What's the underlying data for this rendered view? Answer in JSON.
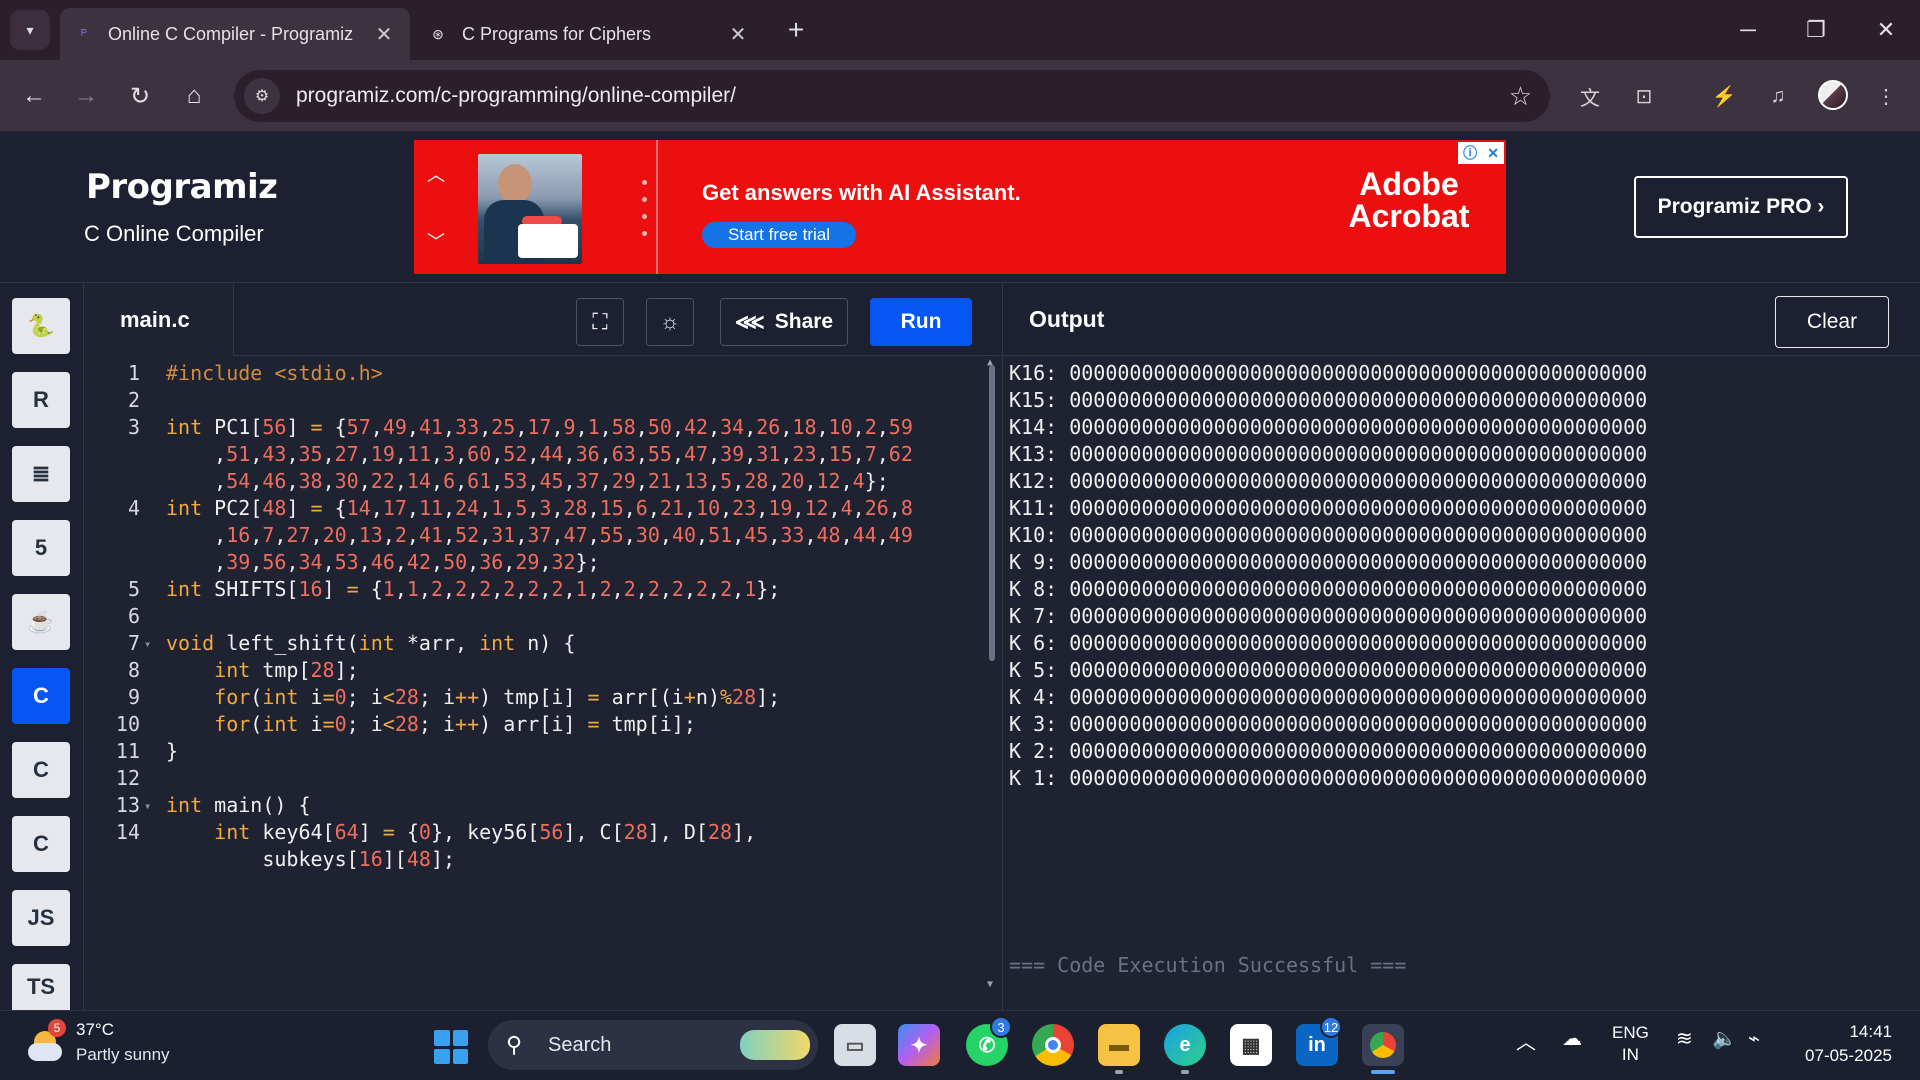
{
  "browser": {
    "tabs": [
      {
        "title": "Online C Compiler - Programiz",
        "active": true
      },
      {
        "title": "C Programs for Ciphers",
        "active": false
      }
    ],
    "url": "programiz.com/c-programming/online-compiler/"
  },
  "site": {
    "logo": "Programiz",
    "subtitle": "C Online Compiler",
    "pro_button": "Programiz PRO ›",
    "ad": {
      "headline": "Get answers with AI Assistant.",
      "cta": "Start free trial",
      "brand": "Adobe Acrobat"
    }
  },
  "rail": {
    "languages": [
      {
        "name": "python",
        "label": "🐍"
      },
      {
        "name": "r",
        "label": "R"
      },
      {
        "name": "sql",
        "label": "≣"
      },
      {
        "name": "html",
        "label": "5"
      },
      {
        "name": "java",
        "label": "☕"
      },
      {
        "name": "c",
        "label": "C",
        "active": true
      },
      {
        "name": "cpp",
        "label": "C"
      },
      {
        "name": "csharp",
        "label": "C"
      },
      {
        "name": "js",
        "label": "JS"
      },
      {
        "name": "ts",
        "label": "TS"
      }
    ]
  },
  "editor": {
    "filename": "main.c",
    "share_label": "Share",
    "run_label": "Run",
    "line_numbers": [
      "1",
      "2",
      "3",
      "",
      "",
      "4",
      "",
      "",
      "5",
      "6",
      "7",
      "8",
      "9",
      "10",
      "11",
      "12",
      "13",
      "14",
      ""
    ],
    "lines": [
      "#include <stdio.h>",
      "",
      "int PC1[56] = {57,49,41,33,25,17,9,1,58,50,42,34,26,18,10,2,59",
      "    ,51,43,35,27,19,11,3,60,52,44,36,63,55,47,39,31,23,15,7,62",
      "    ,54,46,38,30,22,14,6,61,53,45,37,29,21,13,5,28,20,12,4};",
      "int PC2[48] = {14,17,11,24,1,5,3,28,15,6,21,10,23,19,12,4,26,8",
      "    ,16,7,27,20,13,2,41,52,31,37,47,55,30,40,51,45,33,48,44,49",
      "    ,39,56,34,53,46,42,50,36,29,32};",
      "int SHIFTS[16] = {1,1,2,2,2,2,2,2,1,2,2,2,2,2,2,1};",
      "",
      "void left_shift(int *arr, int n) {",
      "    int tmp[28];",
      "    for(int i=0; i<28; i++) tmp[i] = arr[(i+n)%28];",
      "    for(int i=0; i<28; i++) arr[i] = tmp[i];",
      "}",
      "",
      "int main() {",
      "    int key64[64] = {0}, key56[56], C[28], D[28],",
      "        subkeys[16][48];"
    ]
  },
  "output": {
    "title": "Output",
    "clear_label": "Clear",
    "lines": [
      "K16: 000000000000000000000000000000000000000000000000",
      "K15: 000000000000000000000000000000000000000000000000",
      "K14: 000000000000000000000000000000000000000000000000",
      "K13: 000000000000000000000000000000000000000000000000",
      "K12: 000000000000000000000000000000000000000000000000",
      "K11: 000000000000000000000000000000000000000000000000",
      "K10: 000000000000000000000000000000000000000000000000",
      "K 9: 000000000000000000000000000000000000000000000000",
      "K 8: 000000000000000000000000000000000000000000000000",
      "K 7: 000000000000000000000000000000000000000000000000",
      "K 6: 000000000000000000000000000000000000000000000000",
      "K 5: 000000000000000000000000000000000000000000000000",
      "K 4: 000000000000000000000000000000000000000000000000",
      "K 3: 000000000000000000000000000000000000000000000000",
      "K 2: 000000000000000000000000000000000000000000000000",
      "K 1: 000000000000000000000000000000000000000000000000"
    ],
    "status": "=== Code Execution Successful ==="
  },
  "taskbar": {
    "weather_temp": "37°C",
    "weather_desc": "Partly sunny",
    "weather_badge": "5",
    "search_placeholder": "Search",
    "whatsapp_badge": "3",
    "linkedin_badge": "12",
    "lang_top": "ENG",
    "lang_bottom": "IN",
    "time": "14:41",
    "date": "07-05-2025"
  },
  "colors": {
    "accent": "#0556f3",
    "ad_red": "#eb0f0f",
    "keyword": "#f4a93c",
    "number": "#f06d5c"
  }
}
